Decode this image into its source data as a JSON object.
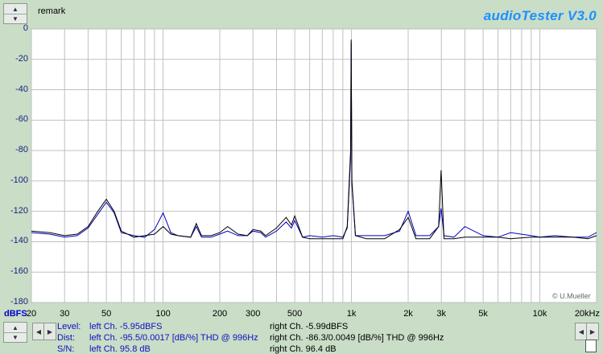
{
  "header": {
    "remark": "remark",
    "brand": "audioTester  V3.0"
  },
  "footer": {
    "level_label": "Level:",
    "dist_label": "Dist:",
    "sn_label": "S/N:",
    "level_left": "left Ch. -5.95dBFS",
    "level_right": "right Ch. -5.99dBFS",
    "dist_left": "left Ch. -95.5/0.0017 [dB/%] THD @ 996Hz",
    "dist_right": "right Ch. -86.3/0.0049 [dB/%] THD @ 996Hz",
    "sn_left": "left Ch. 95.8 dB",
    "sn_right": "right Ch. 96.4 dB"
  },
  "copyright": "© U.Mueller",
  "colors": {
    "left": "#000000",
    "right": "#0000c0",
    "grid": "#c0c0c0",
    "background": "#c9ddc7",
    "plot": "#ffffff"
  },
  "icons": [
    "spin-up-icon",
    "spin-down-icon",
    "arrow-left-icon",
    "arrow-right-icon",
    "page-icon"
  ],
  "chart_data": {
    "type": "line",
    "xscale": "log",
    "xlim": [
      20,
      20000
    ],
    "ylim": [
      -180,
      0
    ],
    "ylabel": "dBFS",
    "yticks": [
      0,
      -20,
      -40,
      -60,
      -80,
      -100,
      -120,
      -140,
      -160,
      -180
    ],
    "ytick_labels": [
      "0",
      "-20",
      "-40",
      "-60",
      "-80",
      "-100",
      "-120",
      "-140",
      "-160",
      "-180"
    ],
    "xticks": [
      20,
      30,
      50,
      100,
      200,
      300,
      500,
      1000,
      2000,
      3000,
      5000,
      10000,
      20000
    ],
    "xtick_labels": [
      "20",
      "30",
      "50",
      "100",
      "200",
      "300",
      "500",
      "1k",
      "2k",
      "3k",
      "5k",
      "10k",
      "20kHz"
    ],
    "series": [
      {
        "channel": "left",
        "x": [
          20,
          25,
          30,
          35,
          40,
          45,
          50,
          55,
          60,
          70,
          80,
          90,
          100,
          110,
          120,
          140,
          150,
          160,
          180,
          200,
          220,
          250,
          280,
          300,
          330,
          350,
          400,
          450,
          480,
          500,
          550,
          600,
          700,
          800,
          900,
          950,
          990,
          996,
          1005,
          1050,
          1200,
          1500,
          1800,
          2000,
          2200,
          2600,
          2900,
          2990,
          3100,
          3500,
          4000,
          5000,
          6000,
          7000,
          9000,
          10000,
          12000,
          15000,
          18000,
          20000
        ],
        "y": [
          -133,
          -134,
          -136,
          -135,
          -130,
          -120,
          -112,
          -120,
          -133,
          -137,
          -136,
          -135,
          -130,
          -135,
          -136,
          -137,
          -128,
          -136,
          -136,
          -134,
          -130,
          -135,
          -136,
          -132,
          -133,
          -136,
          -131,
          -124,
          -129,
          -123,
          -137,
          -138,
          -138,
          -138,
          -138,
          -130,
          -80,
          -7,
          -100,
          -136,
          -138,
          -138,
          -132,
          -124,
          -138,
          -138,
          -130,
          -93,
          -138,
          -138,
          -137,
          -137,
          -137,
          -138,
          -137,
          -137,
          -137,
          -137,
          -138,
          -136
        ]
      },
      {
        "channel": "right",
        "x": [
          20,
          25,
          30,
          35,
          40,
          45,
          50,
          55,
          60,
          70,
          80,
          90,
          100,
          110,
          120,
          140,
          150,
          160,
          180,
          200,
          220,
          250,
          280,
          300,
          330,
          350,
          400,
          450,
          480,
          500,
          550,
          600,
          700,
          800,
          900,
          950,
          990,
          996,
          1005,
          1050,
          1200,
          1500,
          1800,
          2000,
          2200,
          2600,
          2900,
          2990,
          3100,
          3500,
          4000,
          5000,
          6000,
          7000,
          9000,
          10000,
          12000,
          15000,
          18000,
          20000
        ],
        "y": [
          -134,
          -135,
          -137,
          -136,
          -131,
          -122,
          -114,
          -121,
          -134,
          -136,
          -137,
          -132,
          -121,
          -134,
          -136,
          -137,
          -130,
          -137,
          -137,
          -135,
          -133,
          -136,
          -136,
          -133,
          -134,
          -137,
          -133,
          -127,
          -131,
          -126,
          -137,
          -136,
          -137,
          -136,
          -137,
          -131,
          -85,
          -9,
          -102,
          -136,
          -136,
          -136,
          -133,
          -120,
          -136,
          -136,
          -130,
          -118,
          -136,
          -137,
          -130,
          -136,
          -137,
          -134,
          -136,
          -137,
          -136,
          -137,
          -137,
          -134
        ]
      }
    ],
    "grid": true
  }
}
